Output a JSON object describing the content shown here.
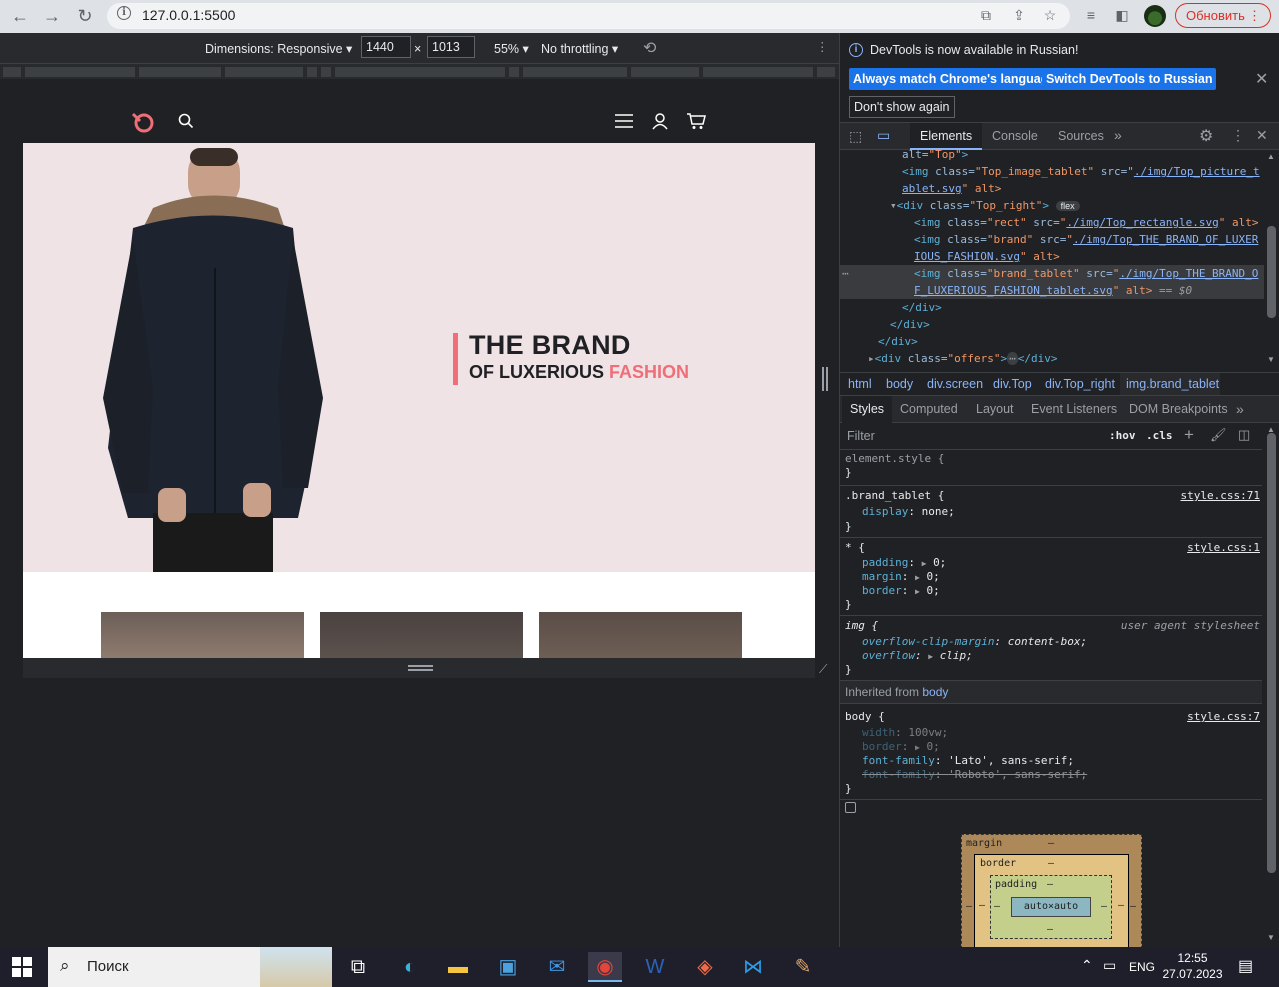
{
  "browser": {
    "url": "127.0.0.1:5500",
    "update_label": "Обновить"
  },
  "device_toolbar": {
    "dimensions_label": "Dimensions: Responsive",
    "width": "1440",
    "times": "×",
    "height": "1013",
    "zoom": "55%",
    "throttling": "No throttling"
  },
  "site": {
    "brand_line1": "THE BRAND",
    "brand_line2a": "OF LUXERIOUS ",
    "brand_line2b": "FASHION"
  },
  "devtools": {
    "info_text": "DevTools is now available in Russian!",
    "btn_match": "Always match Chrome's language",
    "btn_switch": "Switch DevTools to Russian",
    "btn_dont_show": "Don't show again",
    "tabs": [
      "Elements",
      "Console",
      "Sources"
    ],
    "breadcrumbs": [
      "html",
      "body",
      "div.screen",
      "div.Top",
      "div.Top_right",
      "img.brand_tablet"
    ],
    "subtabs": [
      "Styles",
      "Computed",
      "Layout",
      "Event Listeners",
      "DOM Breakpoints"
    ],
    "filter_placeholder": "Filter",
    "hov": ":hov",
    "cls": ".cls",
    "dom_lines": {
      "l0_attr": "alt=",
      "l0_val": "\"Top\"",
      "l1_tag": "<img ",
      "l1_a1": "class=",
      "l1_v1": "\"Top_image_tablet\"",
      "l1_a2": " src=",
      "l1_q": "\"",
      "l1_link": "./img/Top_picture_t",
      "l2_link": "ablet.svg",
      "l2_rest": "\" alt>",
      "l3_tag": "<div ",
      "l3_a": "class=",
      "l3_v": "\"Top_right\"",
      "l3_end": ">",
      "l3_badge": "flex",
      "l4_tag": "<img ",
      "l4_a1": "class=",
      "l4_v1": "\"rect\"",
      "l4_a2": " src=",
      "l4_link": "./img/Top_rectangle.svg",
      "l4_rest": "\" alt>",
      "l5_tag": "<img ",
      "l5_a1": "class=",
      "l5_v1": "\"brand\"",
      "l5_a2": " src=",
      "l5_link": "./img/Top_THE_BRAND_OF_LUXER",
      "l6_link": "IOUS_FASHION.svg",
      "l6_rest": "\" alt>",
      "l7_tag": "<img ",
      "l7_a1": "class=",
      "l7_v1": "\"brand_tablet\"",
      "l7_a2": " src=",
      "l7_link": "./img/Top_THE_BRAND_O",
      "l8_link": "F_LUXERIOUS_FASHION_tablet.svg",
      "l8_rest": "\" alt>",
      "l8_eq": " == $0",
      "l9": "</div>",
      "l10": "</div>",
      "l11": "</div>",
      "l12_tag": "<div ",
      "l12_a": "class=",
      "l12_v": "\"offers\"",
      "l12_mid": ">",
      "l12_end": "</div>",
      "ellipsis": "⋯"
    },
    "styles": {
      "element_style": "element.style {",
      "close": "}",
      "r1_sel": ".brand_tablet {",
      "r1_src": "style.css:71",
      "r1_p1": "display",
      "r1_v1": "none;",
      "r2_sel": "* {",
      "r2_src": "style.css:1",
      "r2_p1": "padding",
      "r2_v1": "0;",
      "r2_p2": "margin",
      "r2_v2": "0;",
      "r2_p3": "border",
      "r2_v3": "0;",
      "r3_sel": "img {",
      "r3_src": "user agent stylesheet",
      "r3_p1": "overflow-clip-margin",
      "r3_v1": "content-box;",
      "r3_p2": "overflow",
      "r3_v2": "clip;",
      "inherited_label": "Inherited from ",
      "inherited_from": "body",
      "r4_sel": "body {",
      "r4_src": "style.css:7",
      "r4_p1": "width",
      "r4_v1": "100vw;",
      "r4_p2": "border",
      "r4_v2": "0;",
      "r4_p3": "font-family",
      "r4_v3": "'Lato', sans-serif;",
      "r4_p4": "font-family",
      "r4_v4": "'Roboto', sans-serif;"
    },
    "box_model": {
      "margin": "margin",
      "border": "border",
      "padding": "padding",
      "dash": "–",
      "content": "auto×auto"
    }
  },
  "taskbar": {
    "search_label": "Поиск",
    "lang": "ENG",
    "time": "12:55",
    "date": "27.07.2023"
  }
}
